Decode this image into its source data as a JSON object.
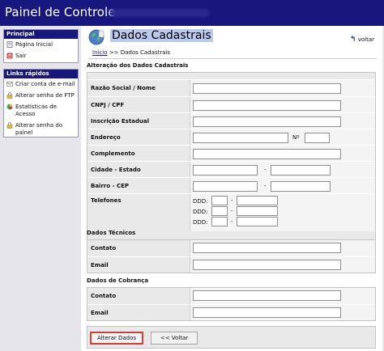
{
  "header": {
    "app_title": "Painel de Controle"
  },
  "sidebar": {
    "principal": {
      "title": "Principal",
      "items": [
        {
          "label": "Página Inicial",
          "icon": "page-icon"
        },
        {
          "label": "Sair",
          "icon": "exit-icon"
        }
      ]
    },
    "links": {
      "title": "Links rápidos",
      "items": [
        {
          "label": "Criar conta de e-mail",
          "icon": "envelope-icon"
        },
        {
          "label": "Alterar senha de FTP",
          "icon": "lock-icon"
        },
        {
          "label": "Estatísticas de Acesso",
          "icon": "stats-icon"
        },
        {
          "label": "Alterar senha do painel",
          "icon": "lock-icon"
        }
      ]
    }
  },
  "page": {
    "title": "Dados Cadastrais",
    "back_label": "voltar",
    "breadcrumb": {
      "home": "Início",
      "sep": ">>",
      "current": "Dados Cadastrais"
    }
  },
  "form": {
    "section_main": "Alteração dos Dados Cadastrais",
    "labels": {
      "razao": "Razão Social / Nome",
      "cnpj": "CNPJ / CPF",
      "inscricao": "Inscrição Estadual",
      "endereco": "Endereço",
      "numero": "Nº",
      "complemento": "Complemento",
      "cidade": "Cidade - Estado",
      "bairro": "Bairro - CEP",
      "telefones": "Telefones",
      "ddd": "DDD:",
      "dash": "-"
    },
    "section_tecnicos": "Dados Técnicos",
    "tecnicos": {
      "contato": "Contato",
      "email": "Email"
    },
    "section_cobranca": "Dados de Cobrança",
    "cobranca": {
      "contato": "Contato",
      "email": "Email"
    }
  },
  "buttons": {
    "save": "Alterar Dados",
    "back": "<< Voltar"
  },
  "colors": {
    "topbar": "#17177e",
    "title_highlight": "#b9c9f0",
    "save_border": "#e03b3b"
  }
}
